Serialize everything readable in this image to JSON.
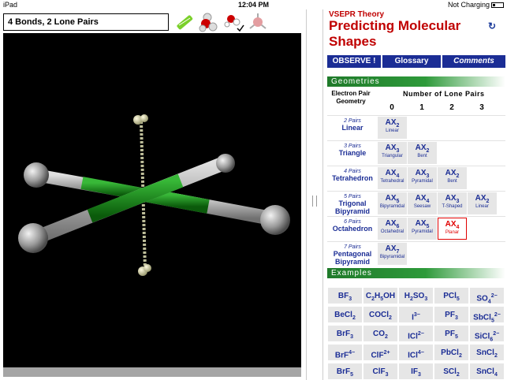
{
  "statusbar": {
    "device": "iPad",
    "time": "12:04 PM",
    "charging": "Not Charging"
  },
  "left": {
    "title": "4 Bonds, 2 Lone Pairs"
  },
  "right": {
    "subtitle": "VSEPR Theory",
    "title": "Predicting Molecular Shapes",
    "buttons": {
      "observe": "OBSERVE !",
      "glossary": "Glossary",
      "comments": "Comments"
    },
    "geometries_label": "Geometries",
    "examples_label": "Examples",
    "header_electron": "Electron Pair Geometry",
    "header_lone": "Number of Lone Pairs",
    "col_numbers": [
      "0",
      "1",
      "2",
      "3"
    ],
    "rows": [
      {
        "pairs": "2 Pairs",
        "name": "Linear",
        "cells": [
          {
            "f": "AX2",
            "g": "Linear"
          }
        ]
      },
      {
        "pairs": "3 Pairs",
        "name": "Triangle",
        "cells": [
          {
            "f": "AX3",
            "g": "Triangular"
          },
          {
            "f": "AX2",
            "g": "Bent"
          }
        ]
      },
      {
        "pairs": "4 Pairs",
        "name": "Tetrahedron",
        "cells": [
          {
            "f": "AX4",
            "g": "Tetrahedral"
          },
          {
            "f": "AX3",
            "g": "Pyramidal"
          },
          {
            "f": "AX2",
            "g": "Bent"
          }
        ]
      },
      {
        "pairs": "5 Pairs",
        "name": "Trigonal Bipyramid",
        "cells": [
          {
            "f": "AX5",
            "g": "Bipyramidal"
          },
          {
            "f": "AX4",
            "g": "Seesaw"
          },
          {
            "f": "AX3",
            "g": "T-Shaped"
          },
          {
            "f": "AX2",
            "g": "Linear"
          }
        ]
      },
      {
        "pairs": "6 Pairs",
        "name": "Octahedron",
        "cells": [
          {
            "f": "AX6",
            "g": "Octahedral"
          },
          {
            "f": "AX5",
            "g": "Pyramidal"
          },
          {
            "f": "AX4",
            "g": "Planar"
          }
        ]
      },
      {
        "pairs": "7 Pairs",
        "name": "Pentagonal Bipyramid",
        "cells": [
          {
            "f": "AX7",
            "g": "Bipyramidal"
          }
        ]
      }
    ],
    "examples": [
      [
        "BF3",
        "C2H5OH",
        "H2SO3",
        "PCl5",
        "SO42−"
      ],
      [
        "BeCl2",
        "COCl2",
        "I3−",
        "PF3",
        "SbCl52−"
      ],
      [
        "BrF3",
        "CO2",
        "ICl2−",
        "PF5",
        "SiCl62−"
      ],
      [
        "BrF4−",
        "ClF2+",
        "ICl4−",
        "PbCl2",
        "SnCl2"
      ],
      [
        "BrF5",
        "ClF3",
        "IF3",
        "SCl2",
        "SnCl4"
      ]
    ]
  }
}
